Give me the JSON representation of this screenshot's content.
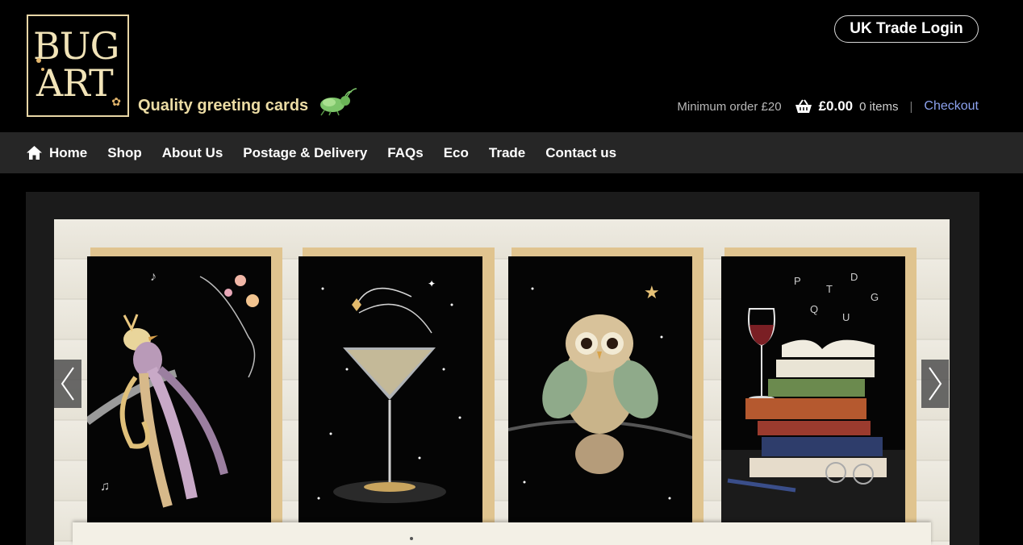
{
  "logo": {
    "line1": "BUG",
    "line2": "ART"
  },
  "header": {
    "tagline": "Quality greeting cards",
    "trade_login": "UK Trade Login",
    "min_order": "Minimum order £20",
    "cart_total": "£0.00",
    "cart_items": "0 items",
    "separator": "|",
    "checkout": "Checkout"
  },
  "nav": {
    "items": [
      {
        "label": "Home",
        "icon": "home-icon"
      },
      {
        "label": "Shop"
      },
      {
        "label": "About Us"
      },
      {
        "label": "Postage & Delivery"
      },
      {
        "label": "FAQs"
      },
      {
        "label": "Eco"
      },
      {
        "label": "Trade"
      },
      {
        "label": "Contact us"
      }
    ]
  },
  "slider": {
    "cards": [
      {
        "subject": "bird-of-paradise"
      },
      {
        "subject": "cocktail-glass"
      },
      {
        "subject": "owl"
      },
      {
        "subject": "books-and-wine"
      }
    ],
    "prev_icon": "chevron-left-icon",
    "next_icon": "chevron-right-icon"
  },
  "colors": {
    "background": "#000000",
    "nav_bg": "#262626",
    "logo_cream": "#f2e4b8",
    "tagline": "#ecdca4",
    "checkout_link": "#8ca2ee",
    "card_mat": "#e0c48f"
  }
}
